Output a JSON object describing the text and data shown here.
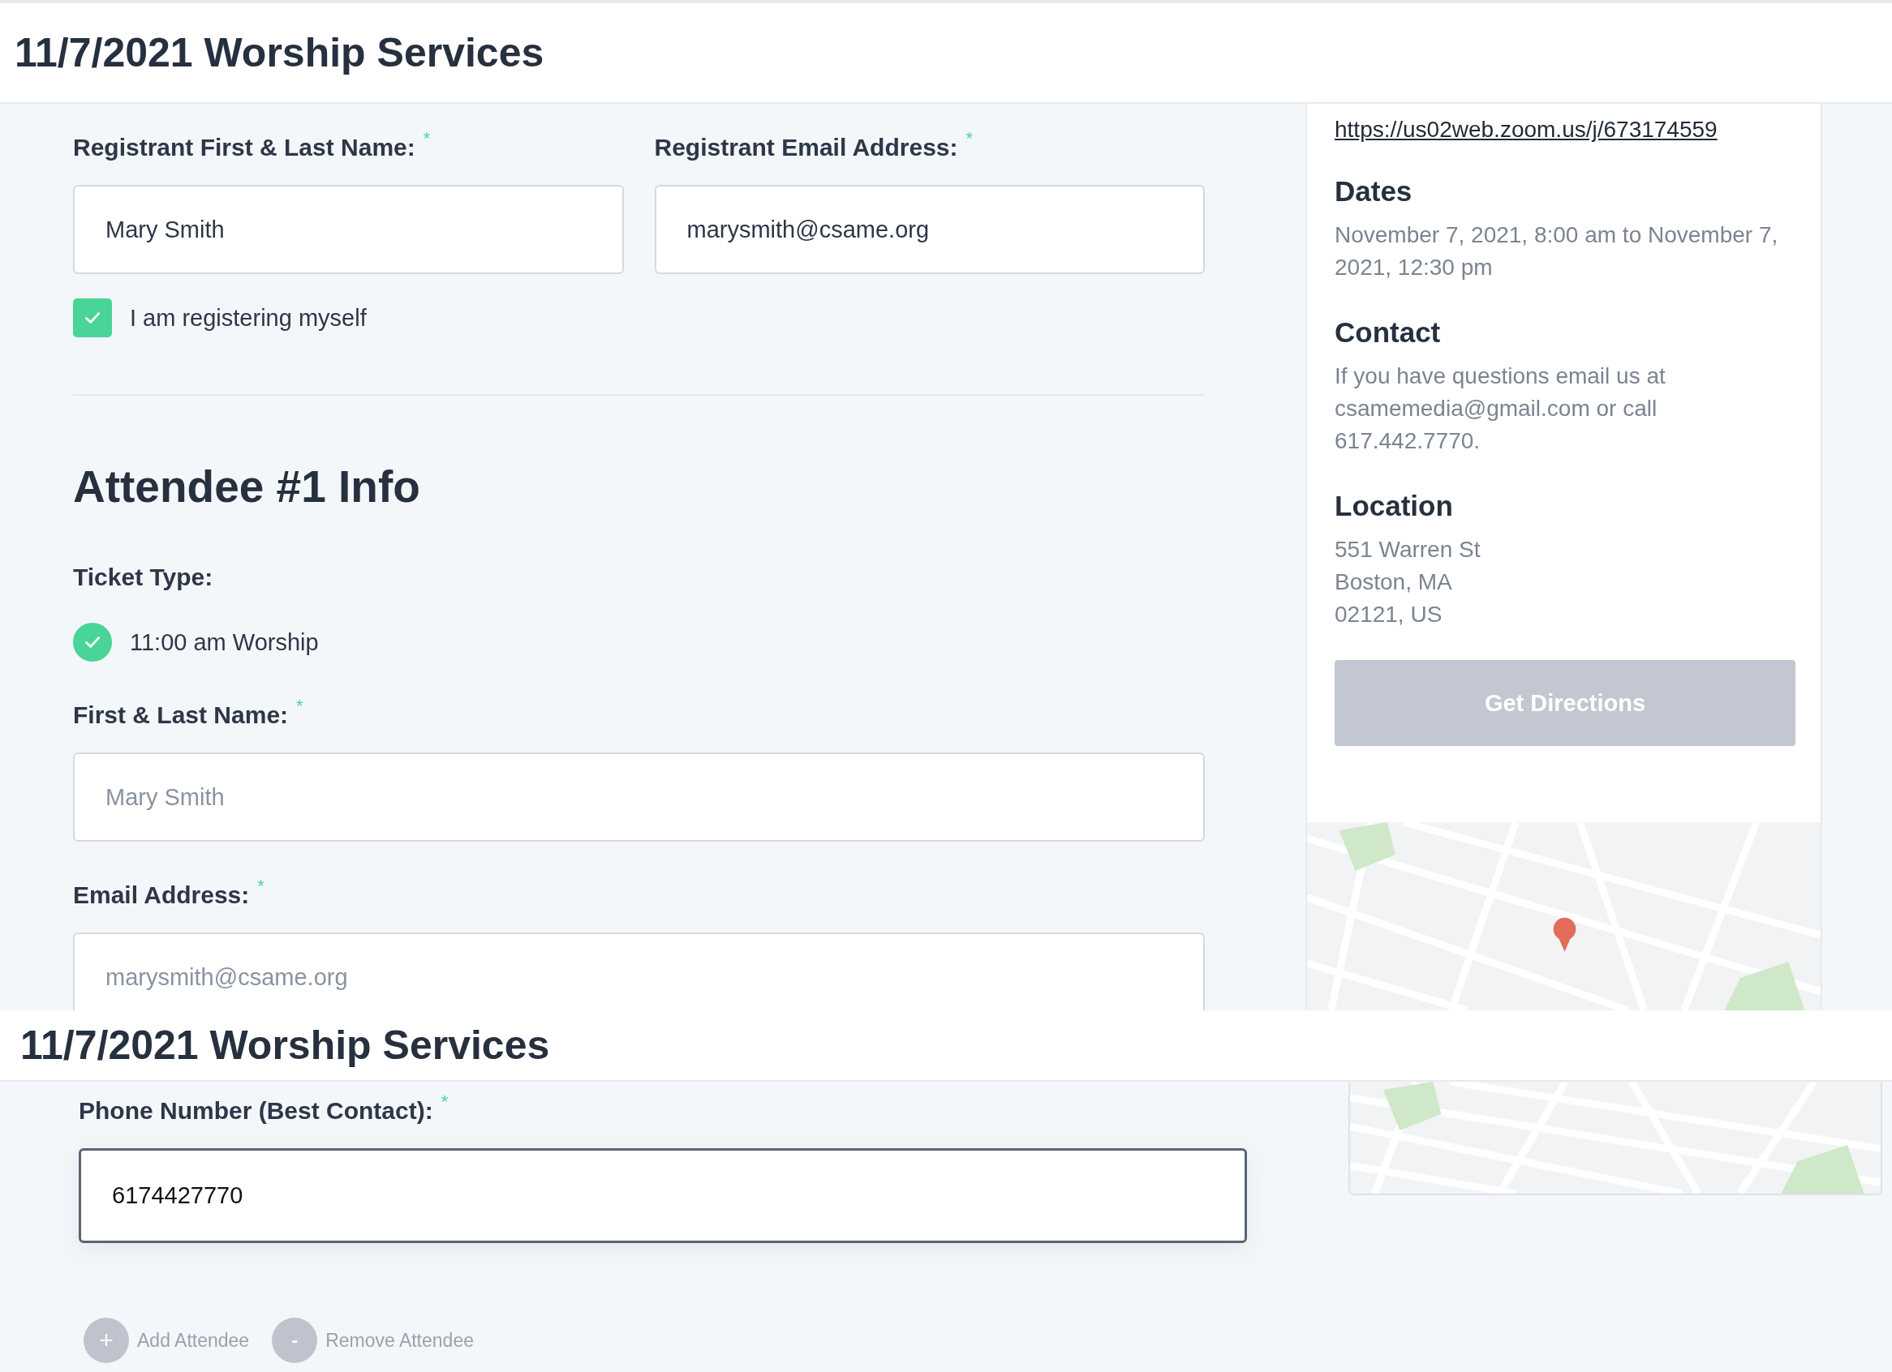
{
  "top_screen": {
    "title": "11/7/2021 Worship Services",
    "registrant_fields": [
      {
        "label": "Registrant First & Last Name:",
        "required_mark": "*",
        "value": "Mary Smith"
      },
      {
        "label": "Registrant Email Address:",
        "required_mark": "*",
        "value": "marysmith@csame.org"
      }
    ],
    "register_self": {
      "label": "I am registering myself",
      "checked": true
    },
    "attendee_heading": "Attendee #1 Info",
    "ticket_type": {
      "label": "Ticket Type:",
      "options": [
        {
          "label": "11:00 am Worship",
          "selected": true
        }
      ]
    },
    "attendee_fields": [
      {
        "label": "First & Last Name:",
        "required_mark": "*",
        "placeholder": "Mary Smith"
      },
      {
        "label": "Email Address:",
        "required_mark": "*",
        "placeholder": "marysmith@csame.org"
      }
    ],
    "sidebar": {
      "link": "https://us02web.zoom.us/j/673174559",
      "sections": [
        {
          "heading": "Dates",
          "lines": [
            "November 7, 2021, 8:00 am to November 7, 2021, 12:30 pm"
          ]
        },
        {
          "heading": "Contact",
          "lines": [
            "If you have questions email us at csamemedia@gmail.com or call 617.442.7770."
          ]
        },
        {
          "heading": "Location",
          "lines": [
            "551 Warren St",
            "Boston, MA",
            "02121, US"
          ]
        }
      ],
      "button": "Get Directions"
    }
  },
  "bottom_screen": {
    "title": "11/7/2021 Worship Services",
    "phone_field": {
      "label": "Phone Number (Best Contact):",
      "required_mark": "*",
      "value": "6174427770",
      "focused": true
    },
    "actions": [
      {
        "kind": "add",
        "symbol": "+",
        "label": "Add Attendee"
      },
      {
        "kind": "remove",
        "symbol": "-",
        "label": "Remove Attendee"
      }
    ]
  }
}
